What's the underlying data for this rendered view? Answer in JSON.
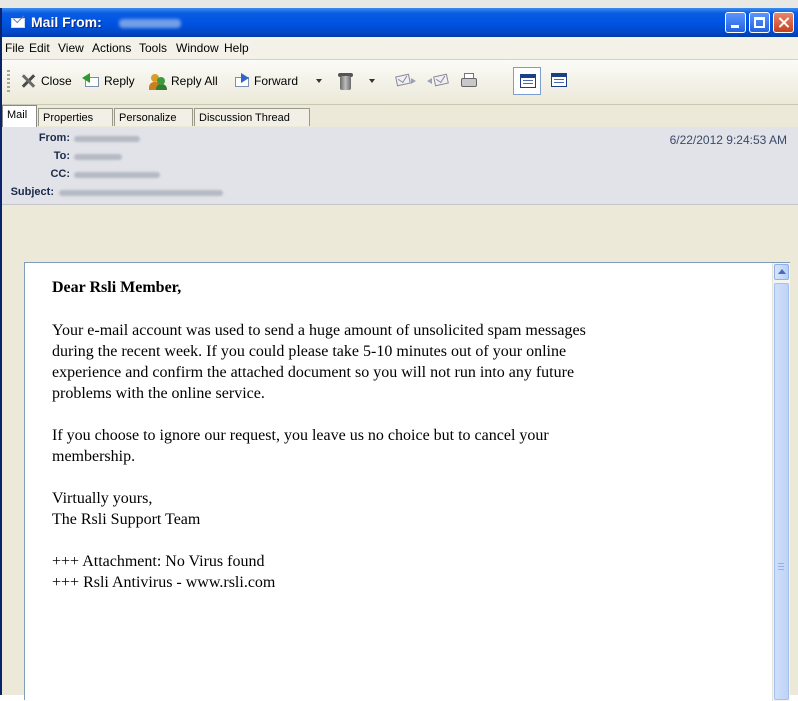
{
  "window": {
    "title": "Mail From:"
  },
  "menu": [
    "File",
    "Edit",
    "View",
    "Actions",
    "Tools",
    "Window",
    "Help"
  ],
  "toolbar": {
    "close_label": "Close",
    "reply_label": "Reply",
    "reply_all_label": "Reply All",
    "forward_label": "Forward"
  },
  "tabs": [
    "Mail",
    "Properties",
    "Personalize",
    "Discussion Thread"
  ],
  "header": {
    "from_label": "From:",
    "to_label": "To:",
    "cc_label": "CC:",
    "subject_label": "Subject:",
    "date": "6/22/2012 9:24:53 AM"
  },
  "message": {
    "greeting": "Dear Rsli Member,",
    "paragraph1_lines": [
      "Your e-mail account was used to send a huge amount of unsolicited spam messages",
      "during the recent week. If you could please take 5-10 minutes out of your online",
      "experience and confirm the attached document so you will not run into any future",
      "problems with the online service."
    ],
    "paragraph2_lines": [
      "If you choose to ignore our request, you leave us no choice but to cancel your",
      "membership."
    ],
    "signoff": "Virtually yours,",
    "signature": "The Rsli Support Team",
    "footer1": "+++ Attachment: No Virus found",
    "footer2": "+++ Rsli Antivirus - www.rsli.com"
  },
  "colors": {
    "titlebar": "#0054e3",
    "close_button": "#c6401d",
    "header_bg": "#e1e3e8"
  }
}
